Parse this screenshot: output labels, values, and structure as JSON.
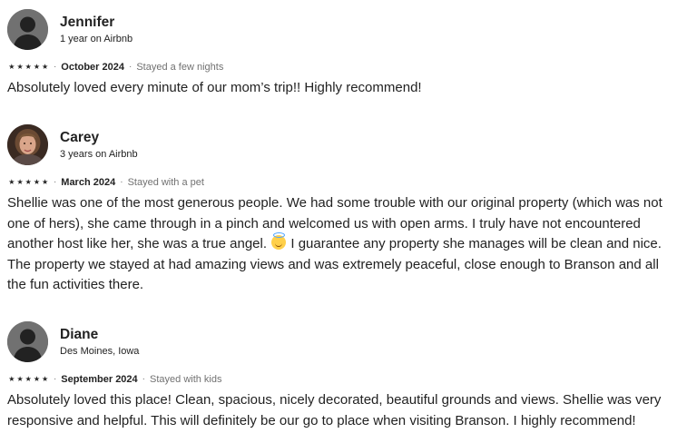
{
  "reviews": [
    {
      "name": "Jennifer",
      "tenure": "1 year on Airbnb",
      "avatar": "default-avatar",
      "rating": 5,
      "date": "October 2024",
      "stay": "Stayed a few nights",
      "text": "Absolutely loved every minute of our mom’s trip!!  Highly recommend!"
    },
    {
      "name": "Carey",
      "tenure": "3 years on Airbnb",
      "avatar": "photo-avatar",
      "rating": 5,
      "date": "March 2024",
      "stay": "Stayed with a pet",
      "text_before_emoji": "Shellie was one of the most generous people. We had some trouble with our original property (which was not one of hers), she came through in a pinch and welcomed us with open arms. I truly have not encountered another host like her, she was a true angel. ",
      "emoji": "smiling-face-with-halo",
      "text_after_emoji": " I guarantee any property she manages will be clean and nice. The property we stayed at had amazing views and was extremely peaceful, close enough to Branson and all the fun activities there."
    },
    {
      "name": "Diane",
      "tenure": "Des Moines, Iowa",
      "avatar": "default-avatar",
      "rating": 5,
      "date": "September 2024",
      "stay": "Stayed with kids",
      "text": "Absolutely loved this place! Clean, spacious, nicely decorated, beautiful grounds and views. Shellie was very responsive and helpful. This will definitely be our go to place when visiting Branson. I highly recommend!"
    }
  ],
  "separator": "·",
  "star_glyph": "★",
  "colors": {
    "text": "#222222",
    "muted": "#717171",
    "default_avatar_bg": "#717171"
  }
}
